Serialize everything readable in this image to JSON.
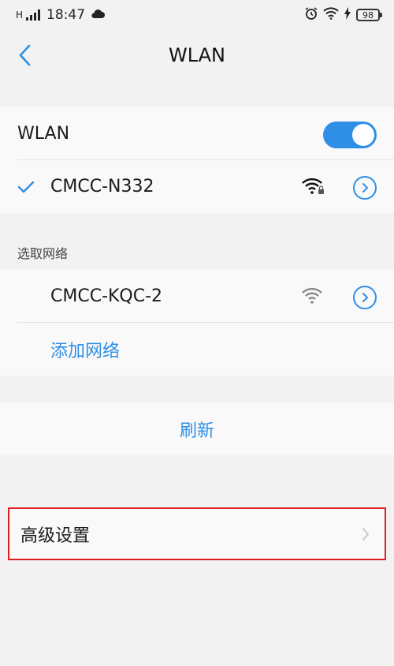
{
  "status": {
    "carrier": "H",
    "time": "18:47",
    "battery": "98",
    "icons": [
      "signal-icon",
      "cloud-icon",
      "alarm-icon",
      "wifi-icon",
      "charging-icon"
    ]
  },
  "nav": {
    "title": "WLAN"
  },
  "wlan_toggle": {
    "label": "WLAN",
    "on": true
  },
  "connected": {
    "ssid": "CMCC-N332",
    "secured": true
  },
  "select_network": {
    "header": "选取网络",
    "networks": [
      {
        "ssid": "CMCC-KQC-2",
        "secured": false
      }
    ],
    "add_label": "添加网络"
  },
  "refresh_label": "刷新",
  "advanced_label": "高级设置",
  "colors": {
    "accent": "#2f8fe6",
    "highlight_border": "#e02020",
    "background": "#f2f2f2"
  }
}
